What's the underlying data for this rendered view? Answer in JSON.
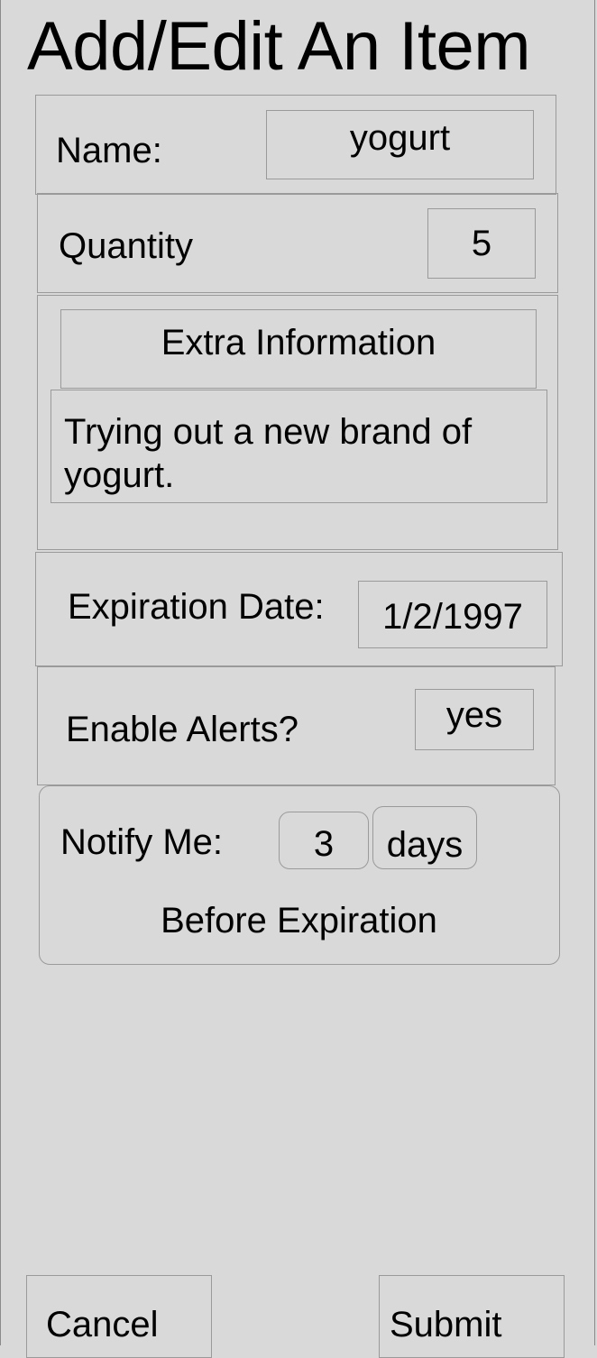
{
  "title": "Add/Edit An Item",
  "name": {
    "label": "Name:",
    "value": "yogurt"
  },
  "quantity": {
    "label": "Quantity",
    "value": "5"
  },
  "extra_info": {
    "header": "Extra Information",
    "text": "Trying out a new brand of yogurt."
  },
  "expiration": {
    "label": "Expiration Date:",
    "value": "1/2/1997"
  },
  "alerts": {
    "label": "Enable Alerts?",
    "value": "yes"
  },
  "notify": {
    "label": "Notify Me:",
    "amount": "3",
    "unit": "days",
    "suffix": "Before Expiration"
  },
  "buttons": {
    "cancel": "Cancel",
    "submit": "Submit"
  }
}
